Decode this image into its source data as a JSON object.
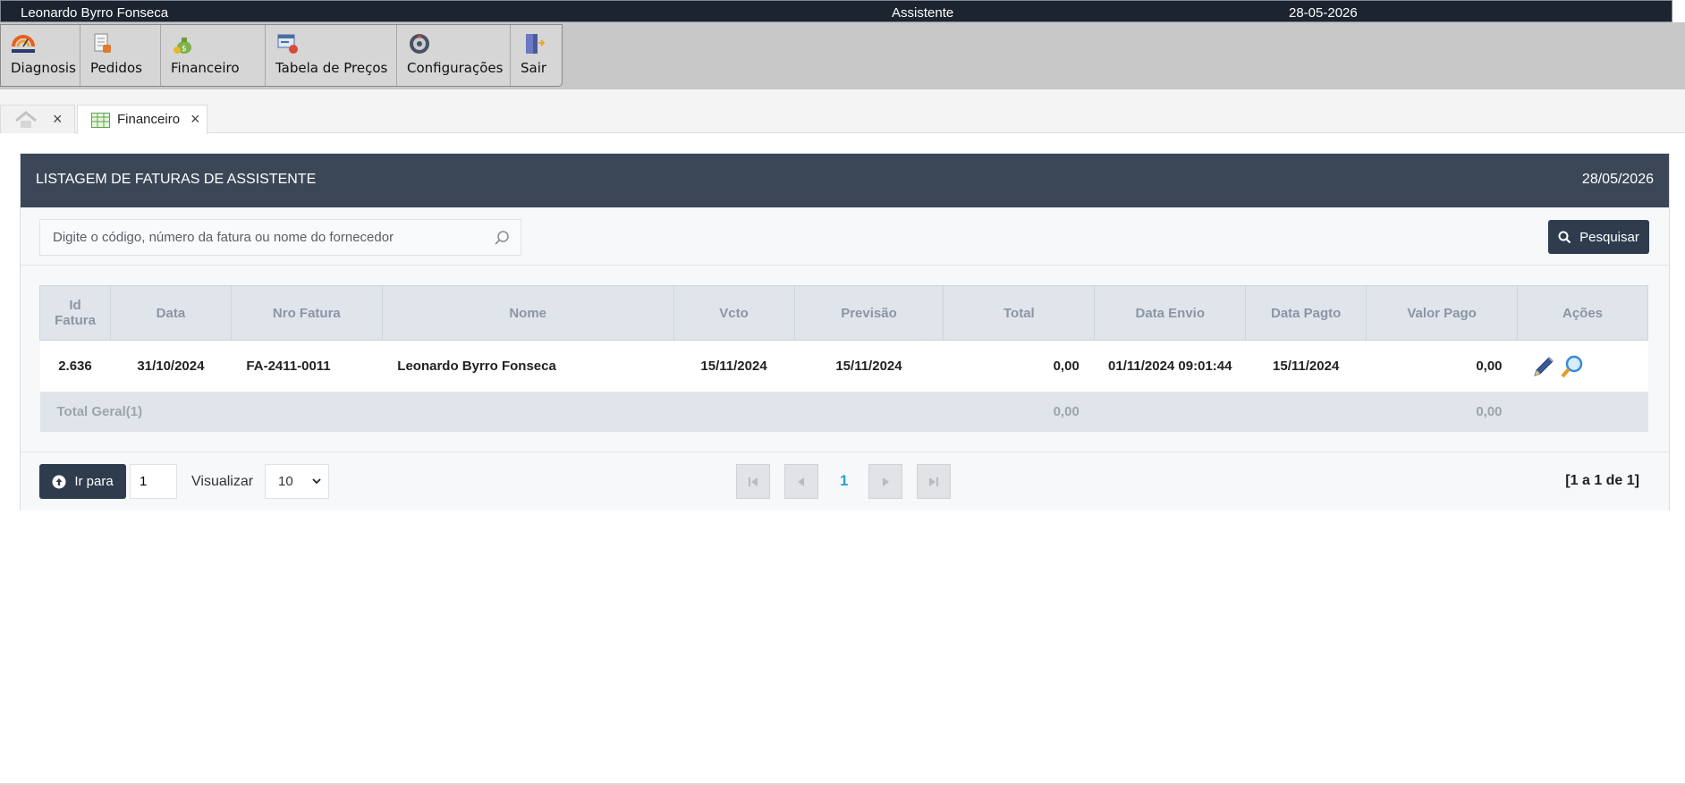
{
  "titlebar": {
    "user": "Leonardo Byrro Fonseca",
    "role": "Assistente",
    "date": "28-05-2026"
  },
  "menu": [
    {
      "label": "Diagnosis",
      "icon": "diagnosis-logo-icon"
    },
    {
      "label": "Pedidos",
      "icon": "orders-icon"
    },
    {
      "label": "Financeiro",
      "icon": "money-bag-icon"
    },
    {
      "label": "Tabela de Preços",
      "icon": "price-table-icon"
    },
    {
      "label": "Configurações",
      "icon": "settings-wheel-icon"
    },
    {
      "label": "Sair",
      "icon": "exit-door-icon"
    }
  ],
  "tabs": {
    "home_close": "×",
    "financeiro_label": "Financeiro",
    "financeiro_close": "×"
  },
  "panel": {
    "title": "LISTAGEM DE FATURAS DE ASSISTENTE",
    "date": "28/05/2026",
    "search_placeholder": "Digite o código, número da fatura ou nome do fornecedor",
    "search_button": "Pesquisar"
  },
  "table": {
    "headers": {
      "id_l1": "Id",
      "id_l2": "Fatura",
      "data": "Data",
      "nro": "Nro Fatura",
      "nome": "Nome",
      "vcto": "Vcto",
      "previsao": "Previsão",
      "total": "Total",
      "data_envio": "Data Envio",
      "data_pagto": "Data Pagto",
      "valor_pago": "Valor Pago",
      "acoes": "Ações"
    },
    "rows": [
      {
        "id": "2.636",
        "data": "31/10/2024",
        "nro": "FA-2411-0011",
        "nome": "Leonardo Byrro Fonseca",
        "vcto": "15/11/2024",
        "previsao": "15/11/2024",
        "total": "0,00",
        "data_envio": "01/11/2024 09:01:44",
        "data_pagto": "15/11/2024",
        "valor_pago": "0,00"
      }
    ],
    "footer": {
      "label": "Total Geral(1)",
      "total": "0,00",
      "valor_pago": "0,00"
    }
  },
  "pager": {
    "go_label": "Ir para",
    "page_value": "1",
    "view_label": "Visualizar",
    "page_size": "10",
    "current_page": "1",
    "info": "[1 a 1 de 1]"
  },
  "colors": {
    "header_dark": "#3b4757",
    "button_dark": "#2e3c4e",
    "titlebar": "#1c2430",
    "link_blue": "#2aa0d6"
  }
}
